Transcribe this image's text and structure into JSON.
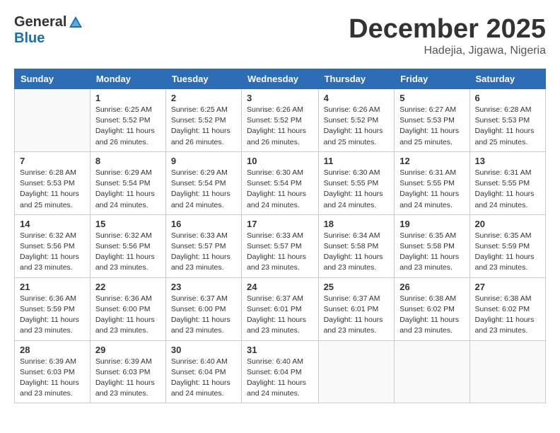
{
  "logo": {
    "general": "General",
    "blue": "Blue"
  },
  "title": "December 2025",
  "location": "Hadejia, Jigawa, Nigeria",
  "days_of_week": [
    "Sunday",
    "Monday",
    "Tuesday",
    "Wednesday",
    "Thursday",
    "Friday",
    "Saturday"
  ],
  "weeks": [
    [
      {
        "day": "",
        "sunrise": "",
        "sunset": "",
        "daylight": ""
      },
      {
        "day": "1",
        "sunrise": "Sunrise: 6:25 AM",
        "sunset": "Sunset: 5:52 PM",
        "daylight": "Daylight: 11 hours and 26 minutes."
      },
      {
        "day": "2",
        "sunrise": "Sunrise: 6:25 AM",
        "sunset": "Sunset: 5:52 PM",
        "daylight": "Daylight: 11 hours and 26 minutes."
      },
      {
        "day": "3",
        "sunrise": "Sunrise: 6:26 AM",
        "sunset": "Sunset: 5:52 PM",
        "daylight": "Daylight: 11 hours and 26 minutes."
      },
      {
        "day": "4",
        "sunrise": "Sunrise: 6:26 AM",
        "sunset": "Sunset: 5:52 PM",
        "daylight": "Daylight: 11 hours and 25 minutes."
      },
      {
        "day": "5",
        "sunrise": "Sunrise: 6:27 AM",
        "sunset": "Sunset: 5:53 PM",
        "daylight": "Daylight: 11 hours and 25 minutes."
      },
      {
        "day": "6",
        "sunrise": "Sunrise: 6:28 AM",
        "sunset": "Sunset: 5:53 PM",
        "daylight": "Daylight: 11 hours and 25 minutes."
      }
    ],
    [
      {
        "day": "7",
        "sunrise": "Sunrise: 6:28 AM",
        "sunset": "Sunset: 5:53 PM",
        "daylight": "Daylight: 11 hours and 25 minutes."
      },
      {
        "day": "8",
        "sunrise": "Sunrise: 6:29 AM",
        "sunset": "Sunset: 5:54 PM",
        "daylight": "Daylight: 11 hours and 24 minutes."
      },
      {
        "day": "9",
        "sunrise": "Sunrise: 6:29 AM",
        "sunset": "Sunset: 5:54 PM",
        "daylight": "Daylight: 11 hours and 24 minutes."
      },
      {
        "day": "10",
        "sunrise": "Sunrise: 6:30 AM",
        "sunset": "Sunset: 5:54 PM",
        "daylight": "Daylight: 11 hours and 24 minutes."
      },
      {
        "day": "11",
        "sunrise": "Sunrise: 6:30 AM",
        "sunset": "Sunset: 5:55 PM",
        "daylight": "Daylight: 11 hours and 24 minutes."
      },
      {
        "day": "12",
        "sunrise": "Sunrise: 6:31 AM",
        "sunset": "Sunset: 5:55 PM",
        "daylight": "Daylight: 11 hours and 24 minutes."
      },
      {
        "day": "13",
        "sunrise": "Sunrise: 6:31 AM",
        "sunset": "Sunset: 5:55 PM",
        "daylight": "Daylight: 11 hours and 24 minutes."
      }
    ],
    [
      {
        "day": "14",
        "sunrise": "Sunrise: 6:32 AM",
        "sunset": "Sunset: 5:56 PM",
        "daylight": "Daylight: 11 hours and 23 minutes."
      },
      {
        "day": "15",
        "sunrise": "Sunrise: 6:32 AM",
        "sunset": "Sunset: 5:56 PM",
        "daylight": "Daylight: 11 hours and 23 minutes."
      },
      {
        "day": "16",
        "sunrise": "Sunrise: 6:33 AM",
        "sunset": "Sunset: 5:57 PM",
        "daylight": "Daylight: 11 hours and 23 minutes."
      },
      {
        "day": "17",
        "sunrise": "Sunrise: 6:33 AM",
        "sunset": "Sunset: 5:57 PM",
        "daylight": "Daylight: 11 hours and 23 minutes."
      },
      {
        "day": "18",
        "sunrise": "Sunrise: 6:34 AM",
        "sunset": "Sunset: 5:58 PM",
        "daylight": "Daylight: 11 hours and 23 minutes."
      },
      {
        "day": "19",
        "sunrise": "Sunrise: 6:35 AM",
        "sunset": "Sunset: 5:58 PM",
        "daylight": "Daylight: 11 hours and 23 minutes."
      },
      {
        "day": "20",
        "sunrise": "Sunrise: 6:35 AM",
        "sunset": "Sunset: 5:59 PM",
        "daylight": "Daylight: 11 hours and 23 minutes."
      }
    ],
    [
      {
        "day": "21",
        "sunrise": "Sunrise: 6:36 AM",
        "sunset": "Sunset: 5:59 PM",
        "daylight": "Daylight: 11 hours and 23 minutes."
      },
      {
        "day": "22",
        "sunrise": "Sunrise: 6:36 AM",
        "sunset": "Sunset: 6:00 PM",
        "daylight": "Daylight: 11 hours and 23 minutes."
      },
      {
        "day": "23",
        "sunrise": "Sunrise: 6:37 AM",
        "sunset": "Sunset: 6:00 PM",
        "daylight": "Daylight: 11 hours and 23 minutes."
      },
      {
        "day": "24",
        "sunrise": "Sunrise: 6:37 AM",
        "sunset": "Sunset: 6:01 PM",
        "daylight": "Daylight: 11 hours and 23 minutes."
      },
      {
        "day": "25",
        "sunrise": "Sunrise: 6:37 AM",
        "sunset": "Sunset: 6:01 PM",
        "daylight": "Daylight: 11 hours and 23 minutes."
      },
      {
        "day": "26",
        "sunrise": "Sunrise: 6:38 AM",
        "sunset": "Sunset: 6:02 PM",
        "daylight": "Daylight: 11 hours and 23 minutes."
      },
      {
        "day": "27",
        "sunrise": "Sunrise: 6:38 AM",
        "sunset": "Sunset: 6:02 PM",
        "daylight": "Daylight: 11 hours and 23 minutes."
      }
    ],
    [
      {
        "day": "28",
        "sunrise": "Sunrise: 6:39 AM",
        "sunset": "Sunset: 6:03 PM",
        "daylight": "Daylight: 11 hours and 23 minutes."
      },
      {
        "day": "29",
        "sunrise": "Sunrise: 6:39 AM",
        "sunset": "Sunset: 6:03 PM",
        "daylight": "Daylight: 11 hours and 23 minutes."
      },
      {
        "day": "30",
        "sunrise": "Sunrise: 6:40 AM",
        "sunset": "Sunset: 6:04 PM",
        "daylight": "Daylight: 11 hours and 24 minutes."
      },
      {
        "day": "31",
        "sunrise": "Sunrise: 6:40 AM",
        "sunset": "Sunset: 6:04 PM",
        "daylight": "Daylight: 11 hours and 24 minutes."
      },
      {
        "day": "",
        "sunrise": "",
        "sunset": "",
        "daylight": ""
      },
      {
        "day": "",
        "sunrise": "",
        "sunset": "",
        "daylight": ""
      },
      {
        "day": "",
        "sunrise": "",
        "sunset": "",
        "daylight": ""
      }
    ]
  ]
}
